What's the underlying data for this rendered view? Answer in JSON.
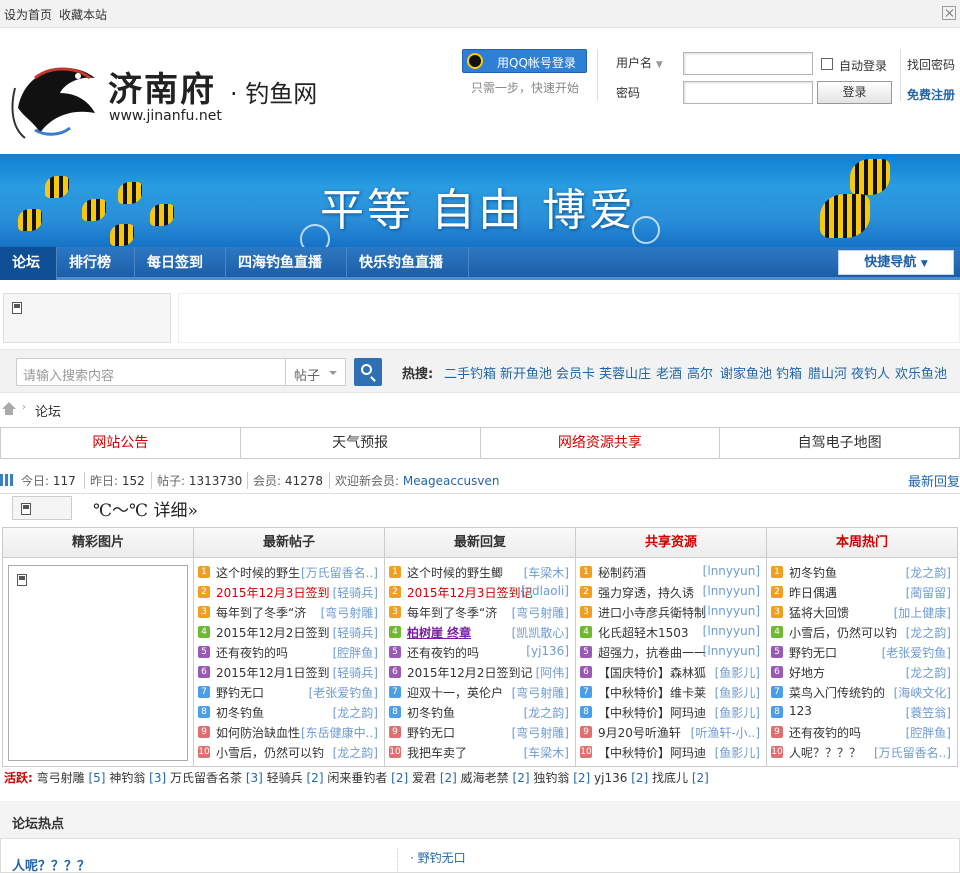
{
  "topbar": {
    "set_home": "设为首页",
    "bookmark": "收藏本站"
  },
  "logo": {
    "name": "济南府",
    "sub": "钓鱼网",
    "url": "www.jinanfu.net"
  },
  "login": {
    "qq_button": "用QQ帐号登录",
    "qq_sub": "只需一步，快速开始",
    "username_label": "用户名",
    "password_label": "密码",
    "auto_login": "自动登录",
    "login_button": "登录",
    "forgot": "找回密码",
    "register": "免费注册"
  },
  "banner": {
    "slogan": "平等 自由 博爱"
  },
  "nav": {
    "items": [
      "论坛",
      "排行榜",
      "每日签到",
      "四海钓鱼直播",
      "快乐钓鱼直播"
    ],
    "quick_nav": "快捷导航"
  },
  "search": {
    "placeholder": "请输入搜索内容",
    "scope": "帖子",
    "hot_label": "热搜:",
    "hot_terms": [
      "二手钓箱",
      "新开鱼池",
      "会员卡",
      "芙蓉山庄",
      "老酒",
      "高尔",
      "谢家鱼池",
      "钓箱",
      "腊山河",
      "夜钓人",
      "欢乐鱼池"
    ]
  },
  "breadcrumb": {
    "current": "论坛"
  },
  "notices": [
    "网站公告",
    "天气预报",
    "网络资源共享",
    "自驾电子地图"
  ],
  "stats": {
    "today_label": "今日:",
    "today": "117",
    "yesterday_label": "昨日:",
    "yesterday": "152",
    "posts_label": "帖子:",
    "posts": "1313730",
    "members_label": "会员:",
    "members": "41278",
    "welcome_label": "欢迎新会员:",
    "newest": "Meageaccusven",
    "latest_reply": "最新回复"
  },
  "weather": {
    "temp": "℃～℃",
    "detail": "详细»"
  },
  "columns": {
    "pics": "精彩图片",
    "new_posts": {
      "title": "最新帖子",
      "rows": [
        {
          "t": "这个时候的野生",
          "a": "[万氏留香名..]"
        },
        {
          "t": "2015年12月3日签到",
          "a": "[轻骑兵]"
        },
        {
          "t": "每年到了冬季“济",
          "a": "[弯弓射雕]"
        },
        {
          "t": "2015年12月2日签到",
          "a": "[轻骑兵]"
        },
        {
          "t": "还有夜钓的吗",
          "a": "[腔胖鱼]"
        },
        {
          "t": "2015年12月1日签到",
          "a": "[轻骑兵]"
        },
        {
          "t": "野钓无口",
          "a": "[老张爱钓鱼]"
        },
        {
          "t": "初冬钓鱼",
          "a": "[龙之韵]"
        },
        {
          "t": "如何防治缺血性",
          "a": "[东岳健康中..]"
        },
        {
          "t": "小雪后，仍然可以钓",
          "a": "[龙之韵]"
        }
      ]
    },
    "new_replies": {
      "title": "最新回复",
      "rows": [
        {
          "t": "这个时候的野生鲫",
          "a": "[车梁木]"
        },
        {
          "t": "2015年12月3日签到记",
          "a": "[sdlaoli]"
        },
        {
          "t": "每年到了冬季“济",
          "a": "[弯弓射雕]"
        },
        {
          "t": "柏树崖  终章",
          "a": "[凯凯散心]"
        },
        {
          "t": "还有夜钓的吗",
          "a": "[yj136]"
        },
        {
          "t": "2015年12月2日签到记",
          "a": "[阿伟]"
        },
        {
          "t": "迎双十一，英伦户",
          "a": "[弯弓射雕]"
        },
        {
          "t": "初冬钓鱼",
          "a": "[龙之韵]"
        },
        {
          "t": "野钓无口",
          "a": "[弯弓射雕]"
        },
        {
          "t": "我把车卖了",
          "a": "[车梁木]"
        }
      ]
    },
    "shared": {
      "title": "共享资源",
      "rows": [
        {
          "t": "秘制药酒",
          "a": "[lnnyyun]"
        },
        {
          "t": "强力穿透，持久诱",
          "a": "[lnnyyun]"
        },
        {
          "t": "进口小寺彦兵衛特制",
          "a": "[lnnyyun]"
        },
        {
          "t": "化氏超轻木1503",
          "a": "[lnnyyun]"
        },
        {
          "t": "超强力，抗卷曲一一",
          "a": "[lnnyyun]"
        },
        {
          "t": "【国庆特价】森林狐",
          "a": "[鱼影儿]"
        },
        {
          "t": "【中秋特价】维卡莱",
          "a": "[鱼影儿]"
        },
        {
          "t": "【中秋特价】阿玛迪",
          "a": "[鱼影儿]"
        },
        {
          "t": "9月20号听渔轩",
          "a": "[听渔轩-小..]"
        },
        {
          "t": "【中秋特价】阿玛迪",
          "a": "[鱼影儿]"
        }
      ]
    },
    "weekly": {
      "title": "本周热门",
      "rows": [
        {
          "t": "初冬钓鱼",
          "a": "[龙之韵]"
        },
        {
          "t": "昨日偶遇",
          "a": "[蔺留留]"
        },
        {
          "t": "猛将大回馈",
          "a": "[加上健康]"
        },
        {
          "t": "小雪后，仍然可以钓",
          "a": "[龙之韵]"
        },
        {
          "t": "野钓无口",
          "a": "[老张爱钓鱼]"
        },
        {
          "t": "好地方",
          "a": "[龙之韵]"
        },
        {
          "t": "菜鸟入门传统钓的",
          "a": "[海峡文化]"
        },
        {
          "t": "123",
          "a": "[蓑笠翁]"
        },
        {
          "t": "还有夜钓的吗",
          "a": "[腔胖鱼]"
        },
        {
          "t": "人呢？？？？",
          "a": "[万氏留香名..]"
        }
      ]
    }
  },
  "active_users": {
    "label": "活跃:",
    "users": [
      {
        "name": "弯弓射雕",
        "count": "[5]"
      },
      {
        "name": "神钓翁",
        "count": "[3]"
      },
      {
        "name": "万氏留香名茶",
        "count": "[3]"
      },
      {
        "name": "轻骑兵",
        "count": "[2]"
      },
      {
        "name": "闲来垂钓者",
        "count": "[2]"
      },
      {
        "name": "爱君",
        "count": "[2]"
      },
      {
        "name": "威海老禁",
        "count": "[2]"
      },
      {
        "name": "独钓翁",
        "count": "[2]"
      },
      {
        "name": "yj136",
        "count": "[2]"
      },
      {
        "name": "找底儿",
        "count": "[2]"
      }
    ]
  },
  "forum_hot": {
    "title": "论坛热点",
    "left_item": "人呢？？？？",
    "right_item": "野钓无口"
  },
  "colors": {
    "nav_blue": "#1c5ea8",
    "link_blue": "#2366a8",
    "red": "#d00000"
  }
}
